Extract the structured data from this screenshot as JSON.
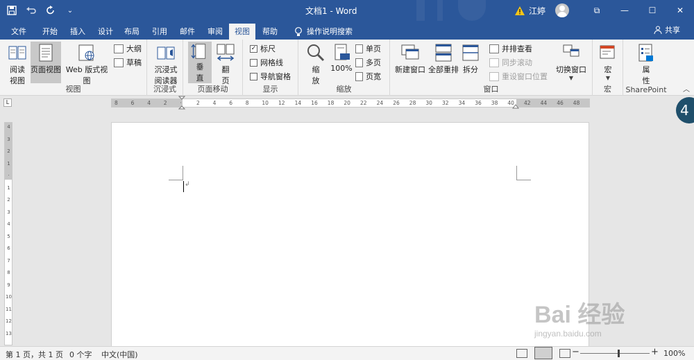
{
  "window": {
    "title": "文档1 - Word",
    "user_name": "江婷",
    "buttons": {
      "ribbon_display": "⧉",
      "minimize": "—",
      "maximize": "☐",
      "close": "✕"
    }
  },
  "quick_access": {
    "save": "save-icon",
    "undo": "undo-icon",
    "redo": "redo-icon",
    "customize": "⌄"
  },
  "tabs": [
    "文件",
    "开始",
    "插入",
    "设计",
    "布局",
    "引用",
    "邮件",
    "审阅",
    "视图",
    "帮助"
  ],
  "active_tab": "视图",
  "tell_me": "操作说明搜索",
  "share": "共享",
  "ribbon": {
    "views": {
      "label": "视图",
      "read_mode": [
        "阅读",
        "视图"
      ],
      "print_layout": "页面视图",
      "web_layout": "Web 版式视图",
      "outline": "大纲",
      "draft": "草稿"
    },
    "immersive": {
      "label": "沉浸式",
      "reader": [
        "沉浸式",
        "阅读器"
      ]
    },
    "page_movement": {
      "label": "页面移动",
      "vertical": [
        "垂",
        "直"
      ],
      "side_to_side": [
        "翻",
        "页"
      ]
    },
    "show": {
      "label": "显示",
      "ruler": "标尺",
      "ruler_checked": true,
      "gridlines": "网格线",
      "gridlines_checked": false,
      "nav_pane": "导航窗格",
      "nav_pane_checked": false
    },
    "zoom": {
      "label": "缩放",
      "zoom": [
        "缩",
        "放"
      ],
      "hundred": "100%",
      "one_page": "单页",
      "multiple_pages": "多页",
      "page_width": "页宽"
    },
    "window": {
      "label": "窗口",
      "new_window": "新建窗口",
      "arrange_all": "全部重排",
      "split": "拆分",
      "side_by_side": "并排查看",
      "sync_scroll": "同步滚动",
      "reset_position": "重设窗口位置",
      "switch_windows": "切换窗口"
    },
    "macros": {
      "label": "宏",
      "macros": "宏"
    },
    "sharepoint": {
      "label": "SharePoint",
      "properties": [
        "属",
        "性"
      ]
    }
  },
  "ruler_numbers": [
    "8",
    "6",
    "4",
    "2",
    "",
    "2",
    "4",
    "6",
    "8",
    "10",
    "12",
    "14",
    "16",
    "18",
    "20",
    "22",
    "24",
    "26",
    "28",
    "30",
    "32",
    "34",
    "36",
    "38",
    "40",
    "42",
    "44",
    "46",
    "48"
  ],
  "vruler_numbers": [
    "4",
    "3",
    "2",
    "1",
    "",
    "1",
    "2",
    "3",
    "4",
    "5",
    "6",
    "7",
    "8",
    "9",
    "10",
    "11",
    "12",
    "13"
  ],
  "badge": "4",
  "status": {
    "page": "第 1 页，共 1 页",
    "words": "0 个字",
    "language": "中文(中国)",
    "zoom_minus": "−",
    "zoom_plus": "+",
    "zoom": "100%",
    "zoom_level": 1.0
  },
  "watermark": {
    "brand": "Bai 经验",
    "url": "jingyan.baidu.com"
  },
  "colors": {
    "accent": "#2b579a",
    "ribbon_bg": "#f3f3f3",
    "page_bg": "#ffffff",
    "canvas_bg": "#e6e6e6"
  }
}
